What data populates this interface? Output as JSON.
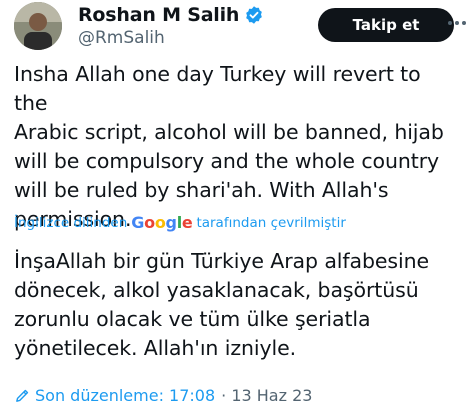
{
  "user": {
    "name": "Roshan M Salih",
    "handle": "@RmSalih"
  },
  "follow_button_label": "Takip et",
  "tweet": {
    "text": "Insha Allah one day Turkey will revert to the\nArabic script, alcohol will be banned, hijab\nwill be compulsory and the whole country\nwill  be ruled by shari'ah. With Allah's\npermission."
  },
  "translation": {
    "prefix": "İngilizce dilinden",
    "provider": "Google",
    "suffix": "tarafından çevrilmiştir",
    "text": "İnşaAllah bir gün Türkiye Arap alfabesine\ndönecek, alkol yasaklanacak, başörtüsü\nzorunlu olacak ve tüm ülke şeriatla\nyönetilecek. Allah'ın izniyle."
  },
  "edit": {
    "label": "Son düzenleme: 17:08",
    "date": "· 13 Haz 23"
  },
  "icons": {
    "verified": "verified-badge-icon",
    "more": "more-options-icon",
    "edit": "pencil-edit-icon"
  },
  "colors": {
    "accent": "#1d9bf0",
    "text": "#0f1419",
    "muted": "#536471",
    "button": "#0f1419"
  }
}
